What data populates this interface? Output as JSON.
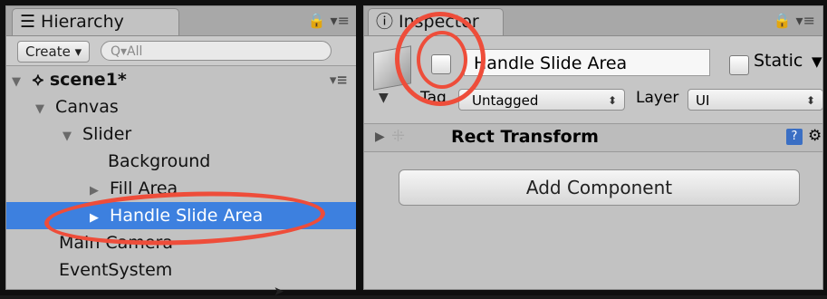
{
  "hierarchy": {
    "tab_label": "Hierarchy",
    "create_label": "Create ▾",
    "search_placeholder": "Q▾All",
    "items": [
      {
        "label": "scene1*",
        "indent": 0,
        "expanded": true
      },
      {
        "label": "Canvas",
        "indent": 1,
        "expanded": true
      },
      {
        "label": "Slider",
        "indent": 2,
        "expanded": true
      },
      {
        "label": "Background",
        "indent": 3,
        "expanded": null
      },
      {
        "label": "Fill Area",
        "indent": 3,
        "expanded": false
      },
      {
        "label": "Handle Slide Area",
        "indent": 3,
        "expanded": false,
        "selected": true
      },
      {
        "label": "Main Camera",
        "indent": 1,
        "expanded": null
      },
      {
        "label": "EventSystem",
        "indent": 1,
        "expanded": null
      }
    ]
  },
  "inspector": {
    "tab_label": "Inspector",
    "object_name": "Handle Slide Area",
    "active_checked": false,
    "static_label": "Static",
    "static_checked": false,
    "tag_label": "Tag",
    "tag_value": "Untagged",
    "layer_label": "Layer",
    "layer_value": "UI",
    "component_title": "Rect Transform",
    "add_component_label": "Add Component"
  },
  "colors": {
    "selection": "#3d80df",
    "annotation": "#ee4d3a",
    "panel": "#c2c2c2"
  }
}
